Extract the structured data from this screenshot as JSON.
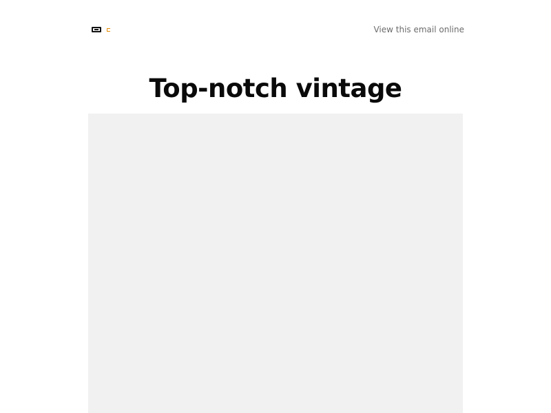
{
  "header": {
    "view_online_label": "View this email online"
  },
  "main": {
    "headline": "Top-notch vintage"
  },
  "colors": {
    "background": "#ffffff",
    "headline": "#0a0a0a",
    "view_online_link": "#6b6b6b",
    "logo_dark": "#111111",
    "logo_accent": "#e88a00",
    "image_placeholder": "#f1f1f1"
  },
  "icons": {
    "logo_mark": "brand-logo-icon",
    "logo_accent": "brand-accent-icon"
  }
}
